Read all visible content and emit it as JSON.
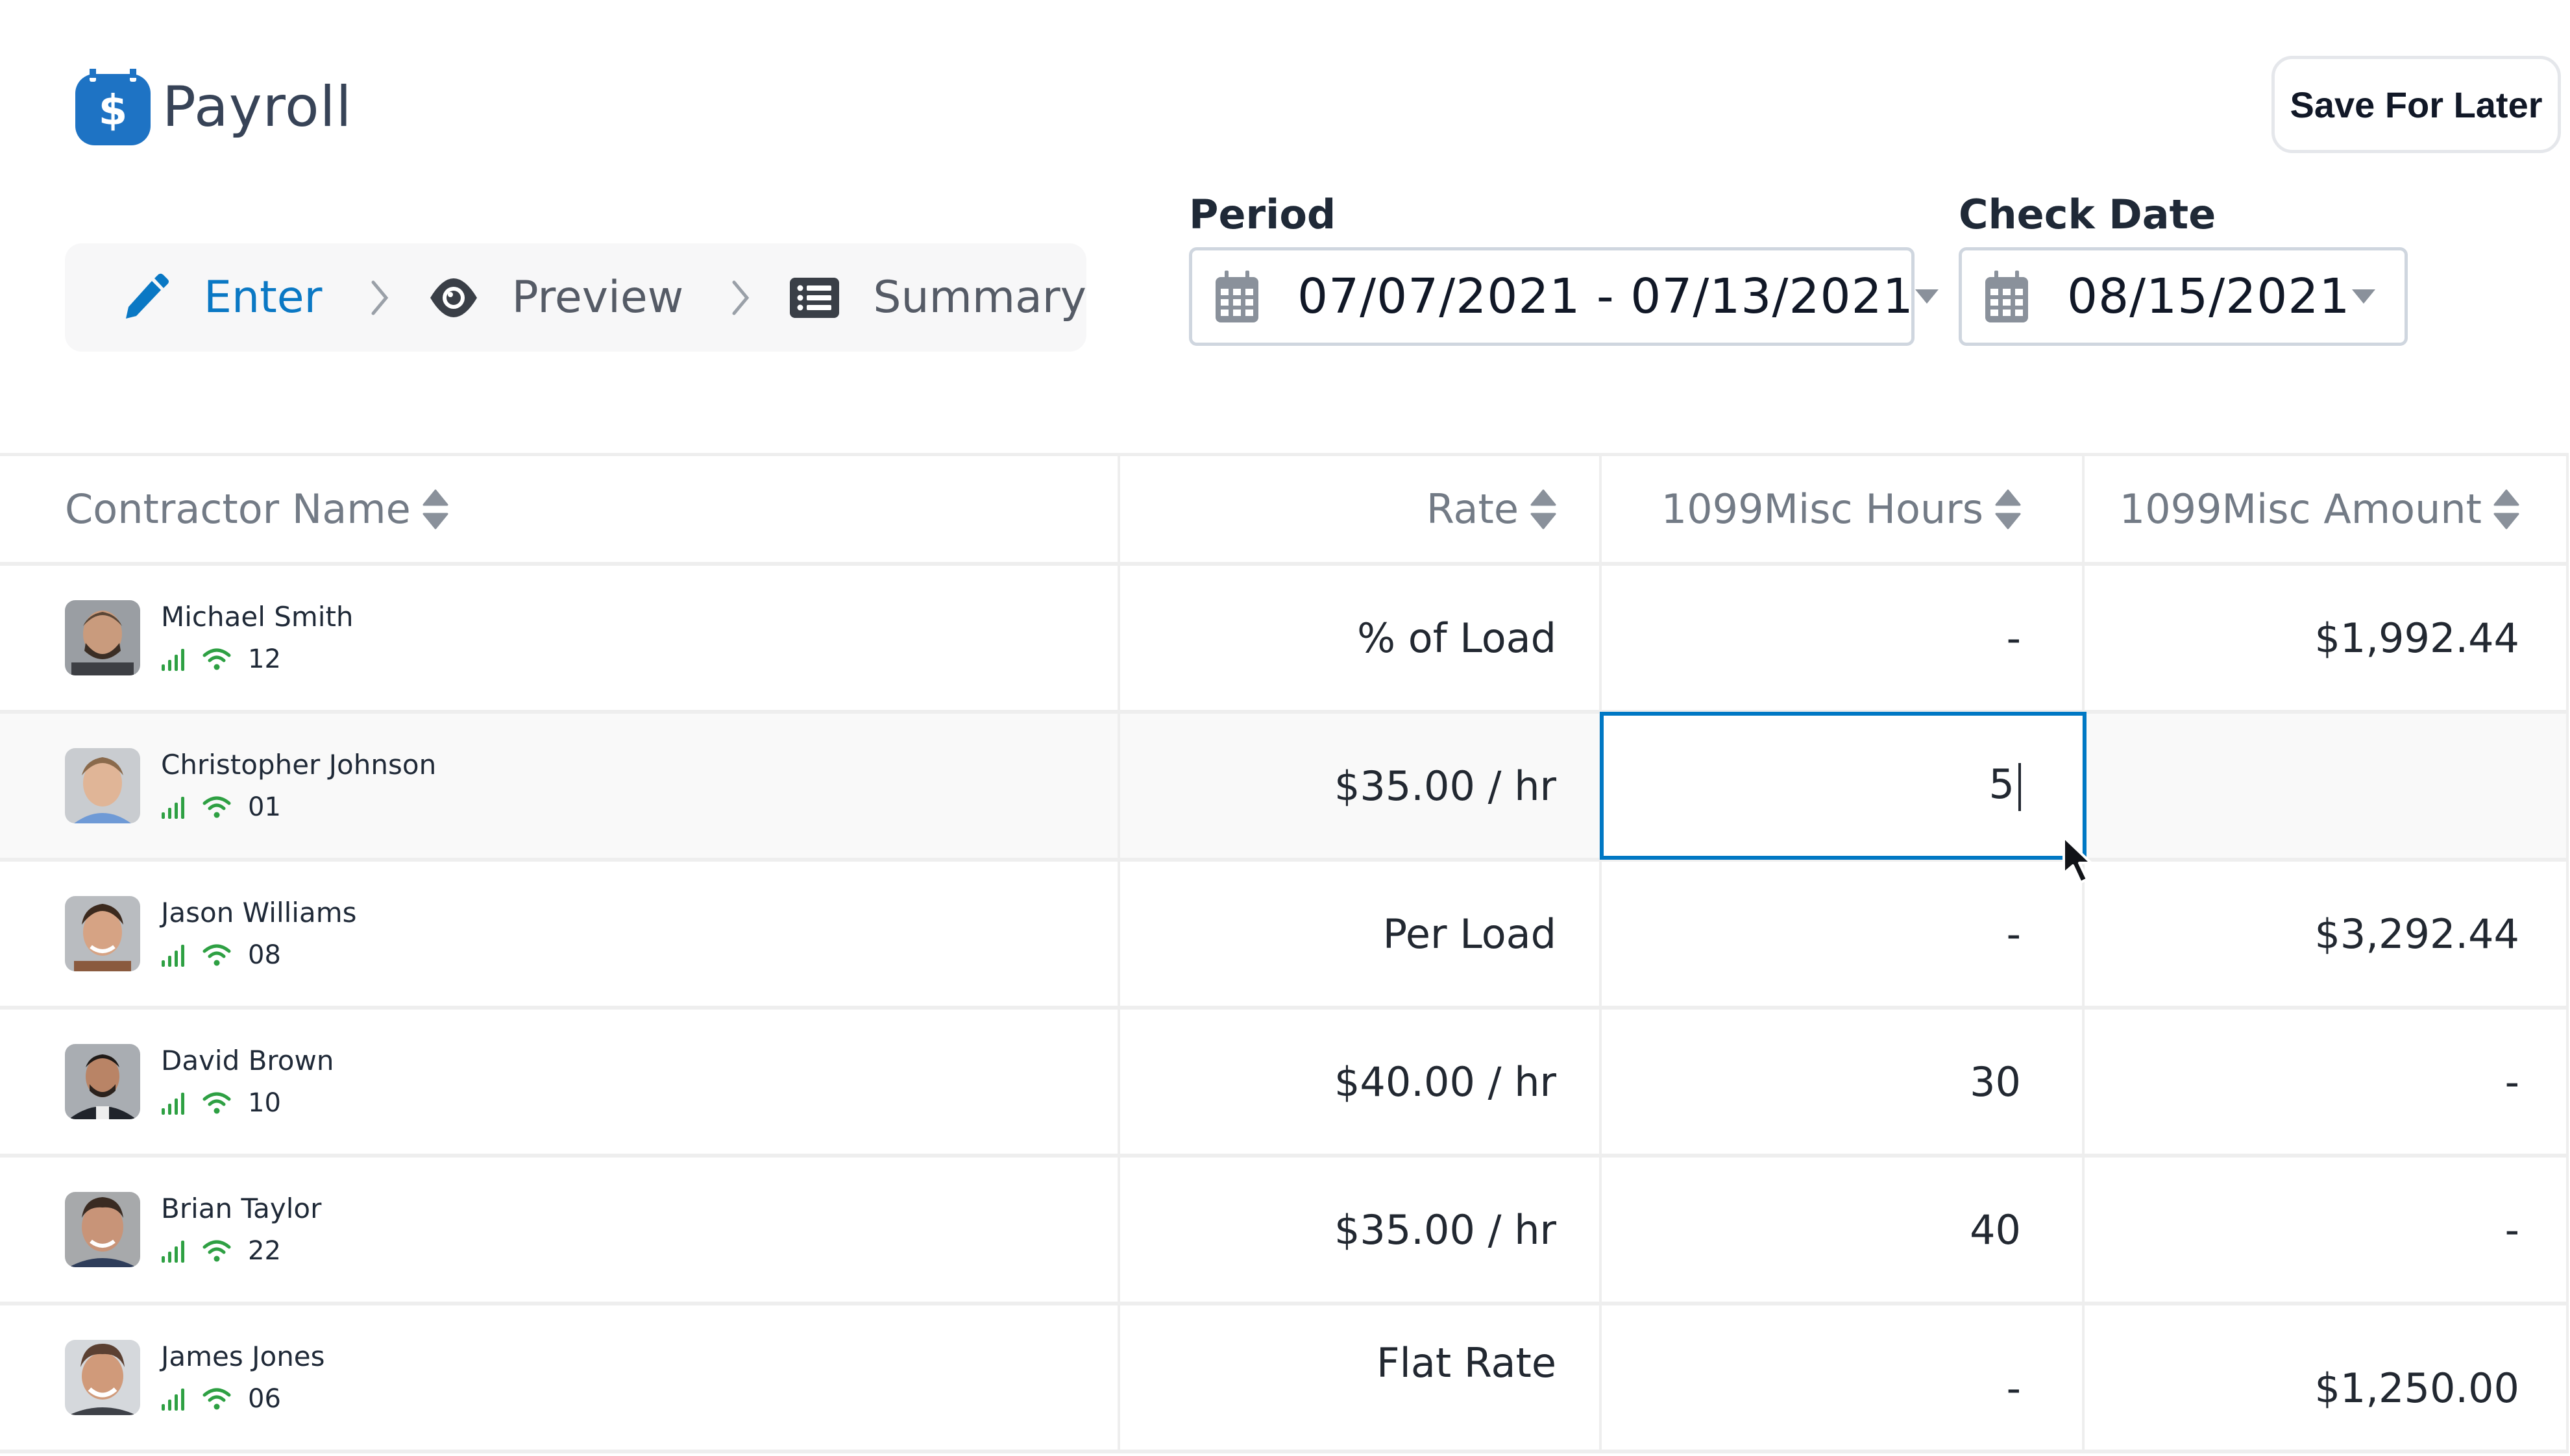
{
  "app": {
    "title": "Payroll",
    "logo_icon": "payroll-calendar-dollar-icon",
    "brand_color": "#1e73c4"
  },
  "toolbar": {
    "save_label": "Save For Later"
  },
  "stepper": {
    "steps": [
      {
        "label": "Enter",
        "icon": "pencil-icon",
        "active": true
      },
      {
        "label": "Preview",
        "icon": "eye-icon",
        "active": false
      },
      {
        "label": "Summary",
        "icon": "list-icon",
        "active": false
      }
    ],
    "active_color": "#0a78c4"
  },
  "filters": {
    "period": {
      "label": "Period",
      "value": "07/07/2021 - 07/13/2021"
    },
    "check_date": {
      "label": "Check Date",
      "value": "08/15/2021"
    }
  },
  "table": {
    "columns": [
      {
        "label": "Contractor Name",
        "sortable": true
      },
      {
        "label": "Rate",
        "sortable": true
      },
      {
        "label": "1099Misc Hours",
        "sortable": true
      },
      {
        "label": "1099Misc Amount",
        "sortable": true
      }
    ],
    "rows": [
      {
        "name": "Michael Smith",
        "id": "12",
        "rate": "% of Load",
        "hours": "-",
        "amount": "$1,992.44"
      },
      {
        "name": "Christopher Johnson",
        "id": "01",
        "rate": "$35.00 / hr",
        "hours": "5",
        "amount": "",
        "editing": true
      },
      {
        "name": "Jason Williams",
        "id": "08",
        "rate": "Per Load",
        "hours": "-",
        "amount": "$3,292.44"
      },
      {
        "name": "David Brown",
        "id": "10",
        "rate": "$40.00 / hr",
        "hours": "30",
        "amount": "-"
      },
      {
        "name": "Brian Taylor",
        "id": "22",
        "rate": "$35.00 / hr",
        "hours": "40",
        "amount": "-"
      },
      {
        "name": "James Jones",
        "id": "06",
        "rate": "Flat Rate",
        "hours": "-",
        "amount": "$1,250.00"
      }
    ],
    "status_color": "#2ea043",
    "edit_border_color": "#0078c4"
  }
}
